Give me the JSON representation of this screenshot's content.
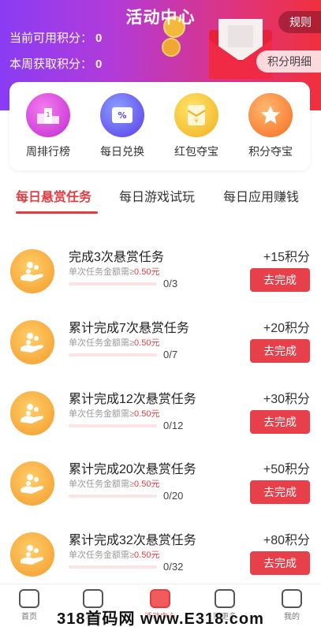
{
  "header": {
    "title": "活动中心",
    "available_points_label": "当前可用积分：",
    "available_points_value": "0",
    "weekly_points_label": "本周获取积分：",
    "weekly_points_value": "0",
    "rules_label": "规则",
    "detail_label": "积分明细"
  },
  "shortcuts": [
    {
      "label": "周排行榜",
      "icon": "podium-icon"
    },
    {
      "label": "每日兑换",
      "icon": "coupon-icon"
    },
    {
      "label": "红包夺宝",
      "icon": "red-envelope-icon"
    },
    {
      "label": "积分夺宝",
      "icon": "star-icon"
    }
  ],
  "tabs": [
    {
      "label": "每日悬赏任务",
      "active": true
    },
    {
      "label": "每日游戏试玩",
      "active": false
    },
    {
      "label": "每日应用赚钱",
      "active": false
    }
  ],
  "tasks": [
    {
      "title": "完成3次悬赏任务",
      "sub_prefix": "单次任务金额需≥",
      "sub_amount": "0.50元",
      "progress": "0/3",
      "reward": "+15积分",
      "button": "去完成"
    },
    {
      "title": "累计完成7次悬赏任务",
      "sub_prefix": "单次任务金额需≥",
      "sub_amount": "0.50元",
      "progress": "0/7",
      "reward": "+20积分",
      "button": "去完成"
    },
    {
      "title": "累计完成12次悬赏任务",
      "sub_prefix": "单次任务金额需≥",
      "sub_amount": "0.50元",
      "progress": "0/12",
      "reward": "+30积分",
      "button": "去完成"
    },
    {
      "title": "累计完成20次悬赏任务",
      "sub_prefix": "单次任务金额需≥",
      "sub_amount": "0.50元",
      "progress": "0/20",
      "reward": "+50积分",
      "button": "去完成"
    },
    {
      "title": "累计完成32次悬赏任务",
      "sub_prefix": "单次任务金额需≥",
      "sub_amount": "0.50元",
      "progress": "0/32",
      "reward": "+80积分",
      "button": "去完成"
    }
  ],
  "bottom_nav": [
    {
      "label": "首页",
      "icon": "home-icon",
      "active": false
    },
    {
      "label": "发布",
      "icon": "publish-icon",
      "active": false
    },
    {
      "label": "活动中心",
      "icon": "gift-icon",
      "active": true
    },
    {
      "label": "赚更多",
      "icon": "money-bag-icon",
      "active": false
    },
    {
      "label": "我的",
      "icon": "profile-icon",
      "active": false
    }
  ],
  "watermark": "318首码网 www.E318.com",
  "colors": {
    "accent": "#e33d42",
    "header_start": "#8a3cf4",
    "header_end": "#f0303c"
  }
}
